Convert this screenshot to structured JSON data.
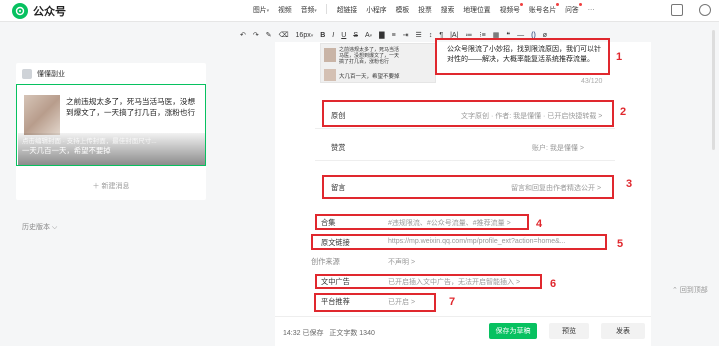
{
  "app": {
    "name": "公众号"
  },
  "toolbar_top": {
    "items": [
      "图片",
      "视频",
      "音频",
      "超链接",
      "小程序",
      "模板",
      "投票",
      "搜索",
      "地理位置",
      "视频号",
      "账号名片",
      "问答",
      "···"
    ]
  },
  "toolbar_format": {
    "font_size": "16px",
    "bold": "B",
    "italic": "I",
    "underline": "U",
    "strike": "S",
    "font_color": "A",
    "link": "()"
  },
  "left_panel": {
    "username": "懂懂副业",
    "article_title": "之前违规太多了，死马当活马医，没想到爆文了，一天搞了打几百，涨粉也行",
    "overlay_line1": "点击编辑封面 · 支持上传封面，最佳封面尺寸...",
    "overlay_line2": "一天几百一天，希望不要掉",
    "add_message": "新建消息",
    "history": "历史版本"
  },
  "editor": {
    "digest_img_line1": "之前违规太多了，死马当活马医，没想到爆文了，一天搞了打几百，涨粉也行",
    "digest_img_line2": "大几百一天，希望不要掉",
    "digest_text": "公众号限流了小妙招，找到限流原因，我们可以针对性的——解决，大概率能复活系统推荐流量。",
    "counter": "43/120",
    "rows": [
      {
        "label": "原创",
        "value": "文字原创 · 作者: 我是懂懂 · 已开启快捷转载 >"
      },
      {
        "label": "赞赏",
        "value": "账户: 我是懂懂 >"
      },
      {
        "label": "留言",
        "value": "留言和回复由作者精选公开 >"
      },
      {
        "label": "合集",
        "value": "#违规限流、#公众号流量、#推荐流量 >"
      },
      {
        "label": "原文链接",
        "value": "https://mp.weixin.qq.com/mp/profile_ext?action=home&..."
      },
      {
        "label": "创作来源",
        "value": "不声明 >"
      },
      {
        "label": "文中广告",
        "value": "已开启插入文中广告，无法开启智能插入 >"
      },
      {
        "label": "平台推荐",
        "value": "已开启 >"
      }
    ],
    "bottom": {
      "time": "14:32",
      "saved": "已保存",
      "word_count_label": "正文字数",
      "word_count": "1340",
      "save_draft": "保存为草稿",
      "preview": "预览",
      "publish": "发表"
    }
  },
  "annotations": [
    "1",
    "2",
    "3",
    "4",
    "5",
    "6",
    "7"
  ],
  "back_to_top": "回到顶部",
  "colors": {
    "accent": "#07c160",
    "annotation": "#e0282e"
  }
}
